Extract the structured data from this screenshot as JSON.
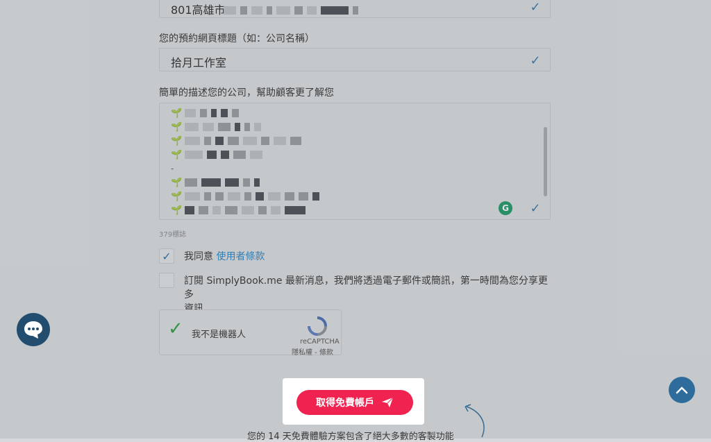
{
  "address": {
    "value": "801高雄市"
  },
  "title_field": {
    "label": "您的預約網頁標題（如：公司名稱）",
    "value": "拾月工作室"
  },
  "description": {
    "label": "簡單的描述您的公司，幫助顧客更了解您",
    "counter": "379標誌"
  },
  "agree": {
    "text": "我同意",
    "link": "使用者條款"
  },
  "subscribe": {
    "text_line1": "訂閱 SimplyBook.me 最新消息，我們將透過電子郵件或簡訊，第一時間為您分享更多",
    "text_line2": "資訊"
  },
  "recaptcha": {
    "label": "我不是機器人",
    "brand": "reCAPTCHA",
    "links": "隱私權 - 條款"
  },
  "cta": {
    "label": "取得免費帳戶"
  },
  "footer": {
    "text": "您的 14 天免費體驗方案包含了絕大多數的客製功能"
  },
  "icons": {
    "check": "check-icon",
    "send": "paper-plane-icon",
    "chat": "chat-icon",
    "up": "chevron-up-icon",
    "grammarly": "grammarly-icon"
  },
  "colors": {
    "cta": "#f0224f",
    "link": "#2b86c5",
    "check": "#3a78a8",
    "chat": "#224d6e"
  }
}
